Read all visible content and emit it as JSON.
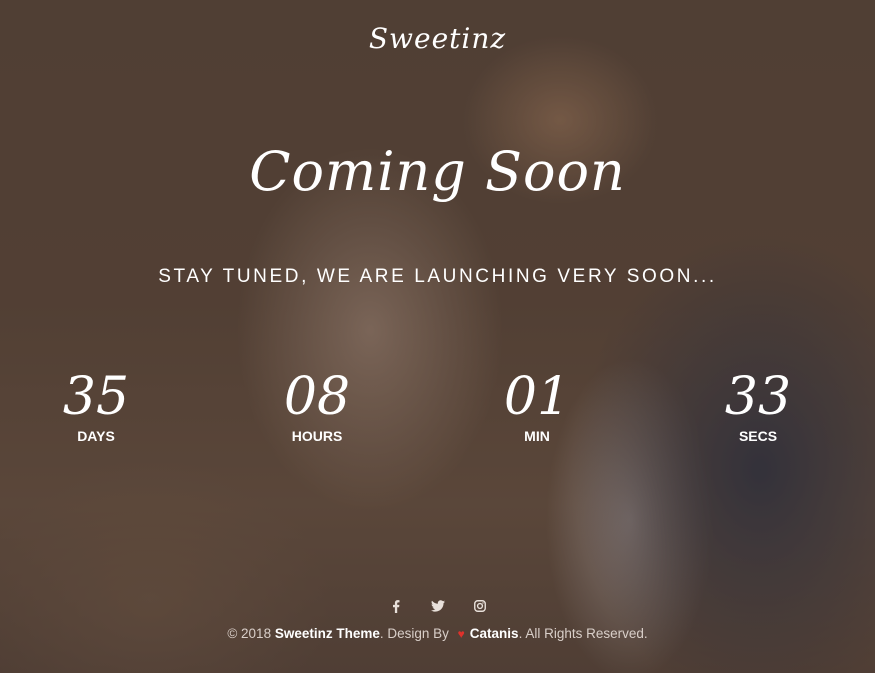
{
  "logo": {
    "text": "Sweetinz"
  },
  "hero": {
    "title": "Coming Soon",
    "tagline": "STAY TUNED, WE ARE LAUNCHING VERY SOON..."
  },
  "countdown": [
    {
      "value": "35",
      "label": "DAYS"
    },
    {
      "value": "08",
      "label": "HOURS"
    },
    {
      "value": "01",
      "label": "MIN"
    },
    {
      "value": "33",
      "label": "SECS"
    }
  ],
  "social": [
    "facebook-icon",
    "twitter-icon",
    "instagram-icon"
  ],
  "footer": {
    "copyright": "© 2018",
    "theme": "Sweetinz Theme",
    "design_by": ". Design By",
    "author": "Catanis",
    "rights": ". All Rights Reserved."
  },
  "colors": {
    "text": "#ffffff",
    "heart": "#e0312b",
    "overlay": "#3c2a22"
  }
}
